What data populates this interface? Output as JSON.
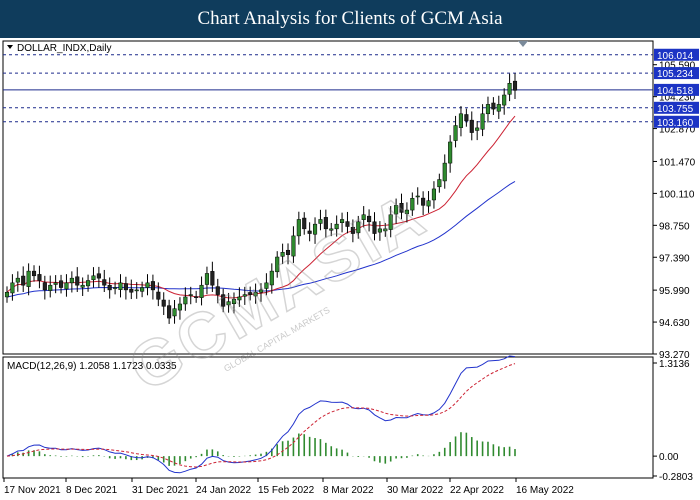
{
  "header": {
    "title": "Chart Analysis for Clients of GCM Asia"
  },
  "watermark": {
    "brand": "GCMASIA",
    "tagline": "GLOBAL CAPITAL MARKETS"
  },
  "chart_data": [
    {
      "type": "candlestick",
      "title": "DOLLAR_INDX,Daily",
      "ylim": [
        93.27,
        106.6
      ],
      "yticks": [
        "105.590",
        "104.230",
        "102.870",
        "101.470",
        "100.110",
        "98.750",
        "97.390",
        "95.990",
        "94.630",
        "93.270"
      ],
      "price_lines": [
        {
          "value": 106.014,
          "label": "106.014",
          "style": "dashed"
        },
        {
          "value": 105.234,
          "label": "105.234",
          "style": "dashed"
        },
        {
          "value": 104.518,
          "label": "104.518",
          "style": "solid"
        },
        {
          "value": 103.755,
          "label": "103.755",
          "style": "dashed"
        },
        {
          "value": 103.16,
          "label": "103.160",
          "style": "dashed"
        }
      ],
      "ma_fast_color": "#cc2233",
      "ma_slow_color": "#2233cc",
      "colors": {
        "up": "#2f8a2f",
        "down": "#222222",
        "label_bg": "#1c34c4"
      },
      "note": "closing prices read approximately from candles, one per trading day",
      "closes": [
        95.9,
        96.3,
        96.5,
        96.2,
        96.8,
        96.6,
        96.4,
        96.0,
        96.2,
        96.3,
        96.1,
        96.3,
        96.5,
        96.2,
        96.2,
        96.4,
        96.6,
        96.5,
        96.2,
        96.0,
        96.1,
        96.3,
        96.0,
        95.9,
        96.0,
        96.1,
        96.3,
        96.0,
        95.6,
        95.3,
        94.8,
        95.2,
        95.4,
        95.7,
        95.8,
        95.7,
        96.2,
        96.7,
        96.2,
        95.8,
        95.3,
        95.5,
        95.6,
        95.7,
        95.8,
        95.8,
        95.9,
        96.0,
        96.3,
        96.8,
        97.4,
        97.6,
        97.5,
        98.3,
        99.0,
        98.6,
        98.4,
        98.8,
        99.0,
        98.6,
        98.6,
        98.8,
        99.0,
        98.7,
        98.4,
        98.9,
        99.2,
        98.9,
        98.4,
        98.6,
        98.6,
        99.2,
        99.6,
        99.3,
        99.4,
        99.9,
        100.0,
        99.6,
        99.8,
        100.3,
        100.7,
        101.4,
        102.3,
        103.0,
        103.5,
        103.2,
        102.7,
        102.9,
        103.5,
        103.9,
        103.7,
        103.9,
        104.3,
        104.8,
        104.5
      ]
    },
    {
      "type": "line",
      "title": "MACD(12,26,9) 1.2058 1.1723 0.0335",
      "ylim": [
        -0.2803,
        1.3136
      ],
      "yticks": [
        "1.3136",
        "0.00",
        "-0.2803"
      ],
      "series": [
        {
          "name": "MACD",
          "color": "#2233cc",
          "style": "solid"
        },
        {
          "name": "Signal",
          "color": "#cc2233",
          "style": "dashed"
        }
      ],
      "histogram_color": "#2f8a2f"
    }
  ],
  "x_axis": {
    "labels": [
      "17 Nov 2021",
      "8 Dec 2021",
      "31 Dec 2021",
      "24 Jan 2022",
      "15 Feb 2022",
      "8 Mar 2022",
      "30 Mar 2022",
      "22 Apr 2022",
      "16 May 2022"
    ]
  }
}
